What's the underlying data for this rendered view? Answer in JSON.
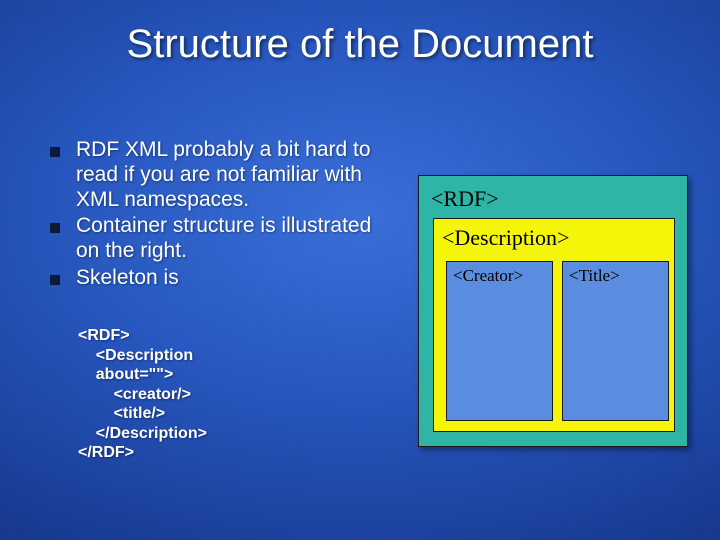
{
  "title": "Structure of the Document",
  "bullets": [
    "RDF XML probably a bit hard to read if you are not familiar with XML namespaces.",
    "Container structure is illustrated on the right.",
    "Skeleton is"
  ],
  "code": {
    "l1": "<RDF>",
    "l2": "    <Description",
    "l3": "    about=\"\">",
    "l4": "        <creator/>",
    "l5": "        <title/>",
    "l6": "    </Description>",
    "l7": "</RDF>"
  },
  "diagram": {
    "rdf": "<RDF>",
    "description": "<Description>",
    "creator": "<Creator>",
    "title": "<Title>"
  }
}
